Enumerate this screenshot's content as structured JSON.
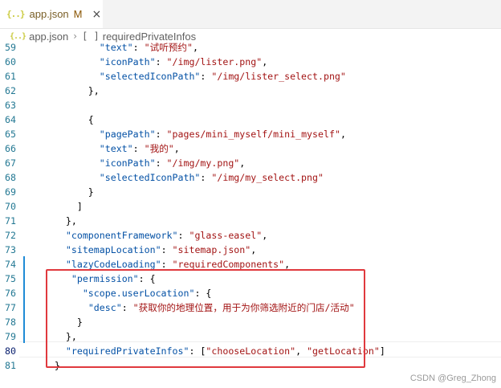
{
  "tab": {
    "icon_text": "{..}",
    "title": "app.json",
    "modified": "M",
    "close": "×"
  },
  "breadcrumb": {
    "icon_text": "{..}",
    "file": "app.json",
    "separator": "›",
    "node_icon": "[ ]",
    "node": "requiredPrivateInfos"
  },
  "lines": [
    {
      "n": "59",
      "t": "            \"text\": \"试听预约\","
    },
    {
      "n": "60",
      "t": "            \"iconPath\": \"/img/lister.png\","
    },
    {
      "n": "61",
      "t": "            \"selectedIconPath\": \"/img/lister_select.png\""
    },
    {
      "n": "62",
      "t": "          },"
    },
    {
      "n": "63",
      "t": ""
    },
    {
      "n": "64",
      "t": "          {"
    },
    {
      "n": "65",
      "t": "            \"pagePath\": \"pages/mini_myself/mini_myself\","
    },
    {
      "n": "66",
      "t": "            \"text\": \"我的\","
    },
    {
      "n": "67",
      "t": "            \"iconPath\": \"/img/my.png\","
    },
    {
      "n": "68",
      "t": "            \"selectedIconPath\": \"/img/my_select.png\""
    },
    {
      "n": "69",
      "t": "          }"
    },
    {
      "n": "70",
      "t": "        ]"
    },
    {
      "n": "71",
      "t": "      },"
    },
    {
      "n": "72",
      "t": "      \"componentFramework\": \"glass-easel\","
    },
    {
      "n": "73",
      "t": "      \"sitemapLocation\": \"sitemap.json\","
    },
    {
      "n": "74",
      "t": "      \"lazyCodeLoading\": \"requiredComponents\","
    },
    {
      "n": "75",
      "t": "       \"permission\": {"
    },
    {
      "n": "76",
      "t": "         \"scope.userLocation\": {"
    },
    {
      "n": "77",
      "t": "          \"desc\": \"获取你的地理位置，用于为你筛选附近的门店/活动\""
    },
    {
      "n": "78",
      "t": "        }"
    },
    {
      "n": "79",
      "t": "      },"
    },
    {
      "n": "80",
      "t": "      \"requiredPrivateInfos\": [\"chooseLocation\", \"getLocation\"]"
    },
    {
      "n": "81",
      "t": "    }"
    }
  ],
  "watermark": "CSDN @Greg_Zhong",
  "colors": {
    "key": "#0451a5",
    "string": "#a31515",
    "line_number": "#237893",
    "highlight_box": "#e0393e"
  }
}
